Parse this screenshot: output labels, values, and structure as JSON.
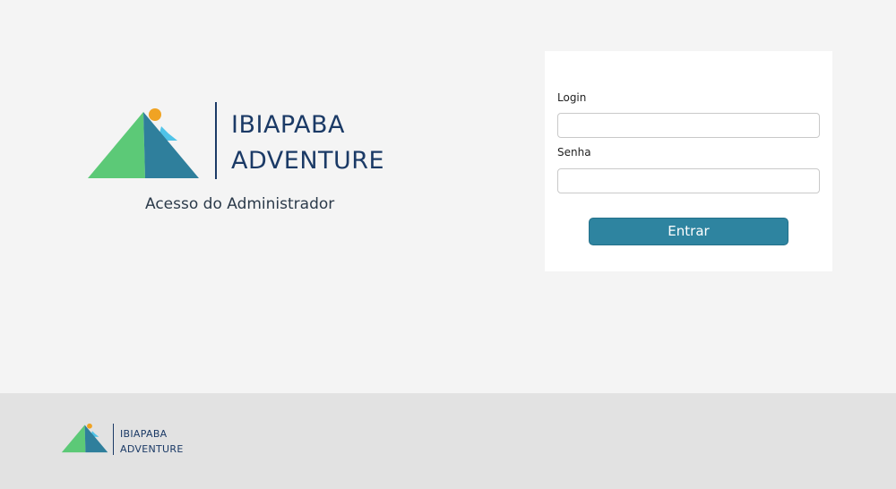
{
  "brand": {
    "line1": "IBIAPABA",
    "line2": "ADVENTURE",
    "subtitle": "Acesso do Administrador",
    "logo_icon": "mountain-sun-logo"
  },
  "login_form": {
    "login_label": "Login",
    "login_value": "",
    "senha_label": "Senha",
    "senha_value": "",
    "submit_label": "Entrar"
  },
  "footer": {
    "line1": "IBIAPABA",
    "line2": "ADVENTURE"
  },
  "colors": {
    "brand_navy": "#1b3a66",
    "button": "#2e84a0",
    "mountain_green": "#5cc977",
    "mountain_teal": "#2f7f9c",
    "sun": "#f0a323",
    "small_peak": "#4fc3e8",
    "background": "#f4f4f4",
    "footer_bg": "#e2e2e2"
  }
}
